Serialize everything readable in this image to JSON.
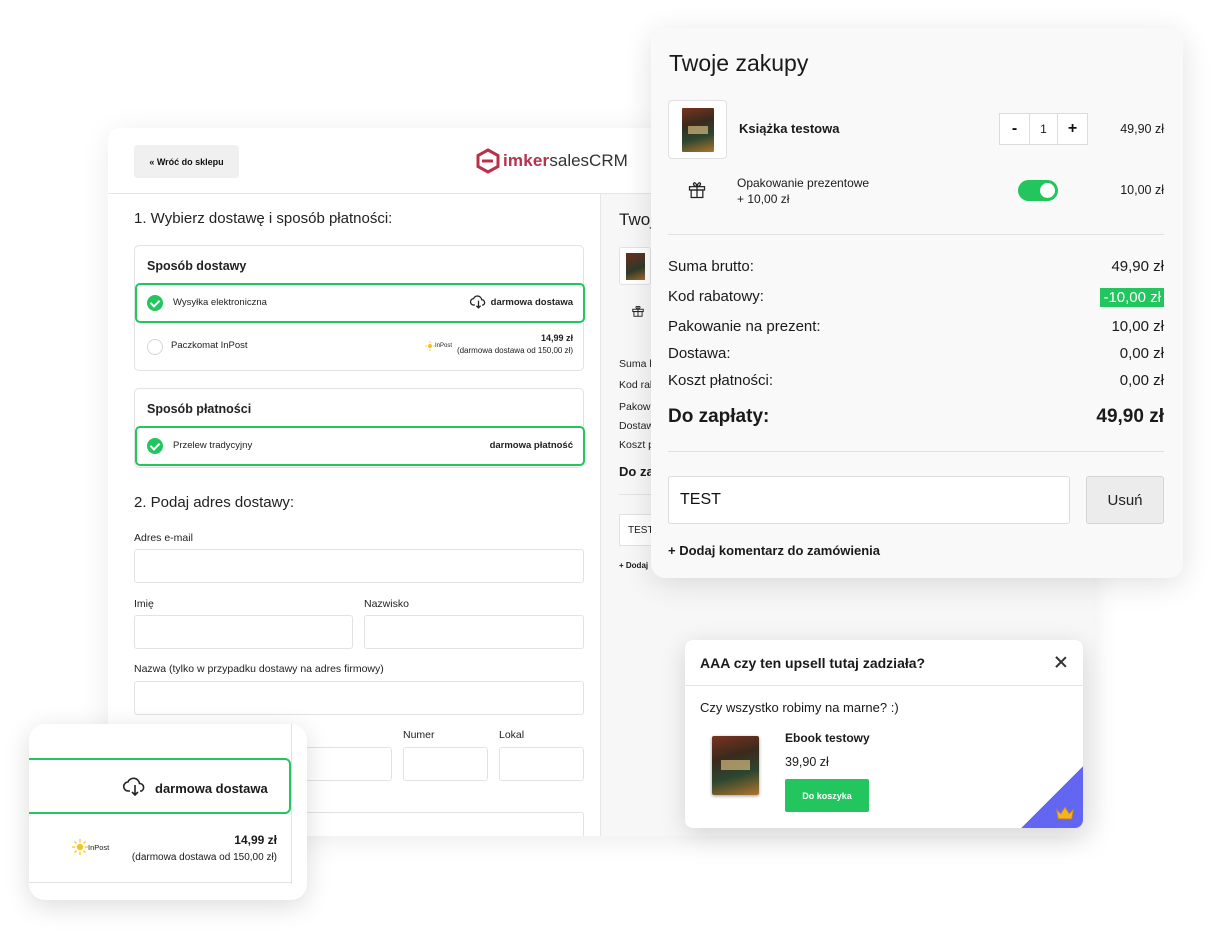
{
  "checkout": {
    "back_label": "« Wróć do sklepu",
    "logo_main": "imker",
    "logo_sub": "salesCRM",
    "step1_title": "1. Wybierz dostawę i sposób płatności:",
    "delivery": {
      "title": "Sposób dostawy",
      "options": [
        {
          "label": "Wysyłka elektroniczna",
          "right": "darmowa dostawa",
          "selected": true
        },
        {
          "label": "Paczkomat InPost",
          "logo": "InPost",
          "price": "14,99 zł",
          "note": "(darmowa dostawa od 150,00 zł)",
          "selected": false
        }
      ]
    },
    "payment": {
      "title": "Sposób płatności",
      "options": [
        {
          "label": "Przelew tradycyjny",
          "right": "darmowa płatność",
          "selected": true
        }
      ]
    },
    "step2_title": "2. Podaj adres dostawy:",
    "fields": {
      "email": "Adres e-mail",
      "first_name": "Imię",
      "last_name": "Nazwisko",
      "company": "Nazwa (tylko w przypadku dostawy na adres firmowy)",
      "number": "Numer",
      "unit": "Lokal"
    },
    "right_panel": {
      "title": "Twoj",
      "rows": [
        "Suma b",
        "Kod rab",
        "Pakowa",
        "Dostaw",
        "Koszt p"
      ],
      "total": "Do za",
      "code": "TEST",
      "add": "+ Dodaj"
    }
  },
  "cart": {
    "title": "Twoje zakupy",
    "item": {
      "name": "Książka testowa",
      "qty": "1",
      "price": "49,90 zł",
      "minus": "-",
      "plus": "+"
    },
    "gift": {
      "label_line1": "Opakowanie prezentowe",
      "label_line2": "+ 10,00 zł",
      "price": "10,00 zł",
      "enabled": true
    },
    "summary": [
      {
        "label": "Suma brutto:",
        "value": "49,90 zł"
      },
      {
        "label": "Kod rabatowy:",
        "value": "-10,00 zł"
      },
      {
        "label": "Pakowanie na prezent:",
        "value": "10,00 zł"
      },
      {
        "label": "Dostawa:",
        "value": "0,00 zł"
      },
      {
        "label": "Koszt płatności:",
        "value": "0,00 zł"
      }
    ],
    "total_label": "Do zapłaty:",
    "total_value": "49,90 zł",
    "discount_code": "TEST",
    "remove_label": "Usuń",
    "add_comment": "+ Dodaj komentarz do zamówienia"
  },
  "upsell": {
    "title": "AAA czy ten upsell tutaj zadziała?",
    "description": "Czy wszystko robimy na marne? :)",
    "product_name": "Ebook testowy",
    "price": "39,90 zł",
    "button": "Do koszyka"
  },
  "zoom": {
    "selected_label": "darmowa dostawa",
    "logo": "InPost",
    "price": "14,99 zł",
    "note": "(darmowa dostawa od 150,00 zł)"
  },
  "colors": {
    "accent_green": "#22c55e",
    "brand_red": "#b8314a",
    "corner_purple": "#6366f1",
    "crown_gold": "#f5b324"
  },
  "icons": [
    "check-icon",
    "cloud-download-icon",
    "gift-icon",
    "close-icon",
    "crown-icon",
    "inpost-logo"
  ]
}
